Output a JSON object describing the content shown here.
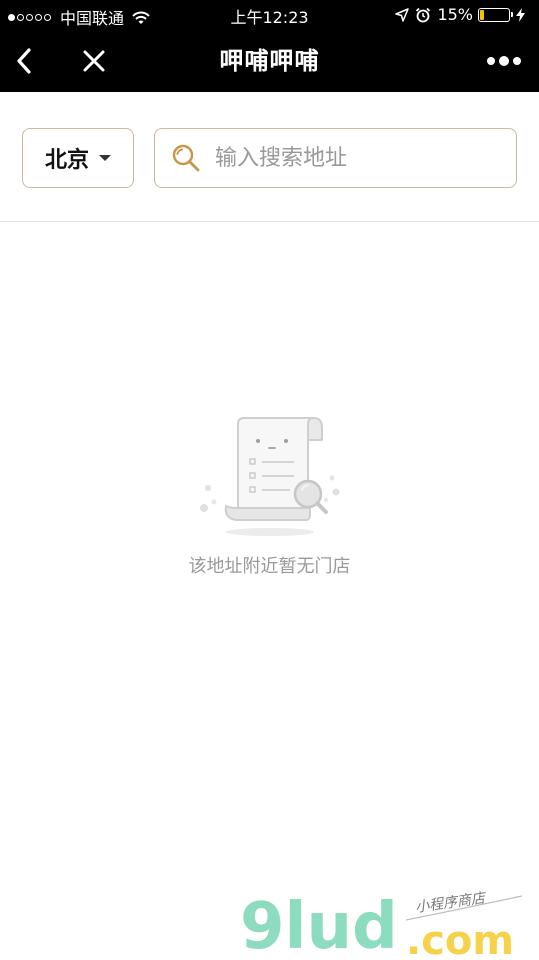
{
  "status_bar": {
    "carrier": "中国联通",
    "time": "上午12:23",
    "battery_percent_text": "15%",
    "battery_level": 0.15,
    "battery_color": "#f5c400",
    "signal_strength": 1,
    "icons": [
      "wifi-icon",
      "location-arrow-icon",
      "alarm-clock-icon",
      "charging-bolt-icon"
    ]
  },
  "nav": {
    "title": "呷哺呷哺",
    "back_icon": "chevron-left-icon",
    "close_icon": "close-icon",
    "more_icon": "more-dots-icon"
  },
  "search": {
    "city": "北京",
    "placeholder": "输入搜索地址",
    "value": "",
    "border_color": "#c9bba0",
    "icon_color": "#c8954a"
  },
  "empty_state": {
    "message": "该地址附近暂无门店",
    "illustration": "empty-receipt-search-icon"
  },
  "watermark": {
    "brand": "9lud",
    "domain": ".com",
    "tagline": "小程序商店"
  }
}
